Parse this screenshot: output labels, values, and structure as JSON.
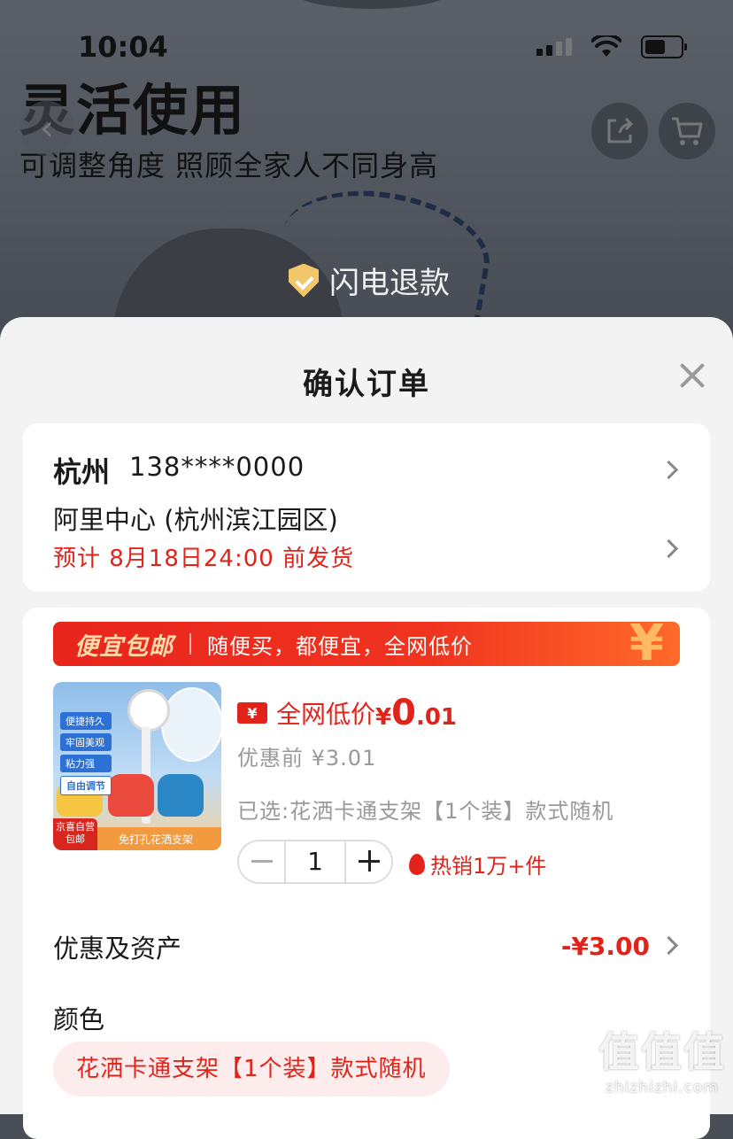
{
  "status_bar": {
    "time": "10:04"
  },
  "banner": {
    "headline": "灵活使用",
    "subline": "可调整角度 照顾全家人不同身高",
    "refund_badge": "闪电退款",
    "icons": [
      "back-arrow-icon",
      "share-icon",
      "cart-icon"
    ]
  },
  "sheet": {
    "title": "确认订单"
  },
  "address": {
    "city": "杭州",
    "phone": "138****0000",
    "detail": "阿里中心 (杭州滨江园区)",
    "shipping": "预计 8月18日24:00 前发货"
  },
  "promo": {
    "tag": "便宜包邮",
    "text": "随便买，都便宜，全网低价",
    "yen": "¥"
  },
  "product": {
    "thumb_features": [
      "便捷持久",
      "牢固美观",
      "粘力强",
      "自由调节"
    ],
    "thumb_badge": "京喜自营 包邮",
    "thumb_caption": "免打孔花洒支架",
    "coupon_icon": "¥",
    "price_label": "全网低价",
    "price_currency": "¥",
    "price_int": "0",
    "price_dec": ".01",
    "original_price": "优惠前 ¥3.01",
    "selected": "已选:花洒卡通支架【1个装】款式随机",
    "quantity": "1",
    "hot_sales": "热销1万+件"
  },
  "discount": {
    "label": "优惠及资产",
    "value": "-¥3.00"
  },
  "color": {
    "label": "颜色",
    "selected_option": "花洒卡通支架【1个装】款式随机"
  },
  "watermark": {
    "big": "值值值",
    "small": "zhizhizhi.com"
  },
  "colors": {
    "accent_red": "#e2231a",
    "promo_gold": "#ffd9a8",
    "sheet_bg": "#f3f3f4"
  }
}
